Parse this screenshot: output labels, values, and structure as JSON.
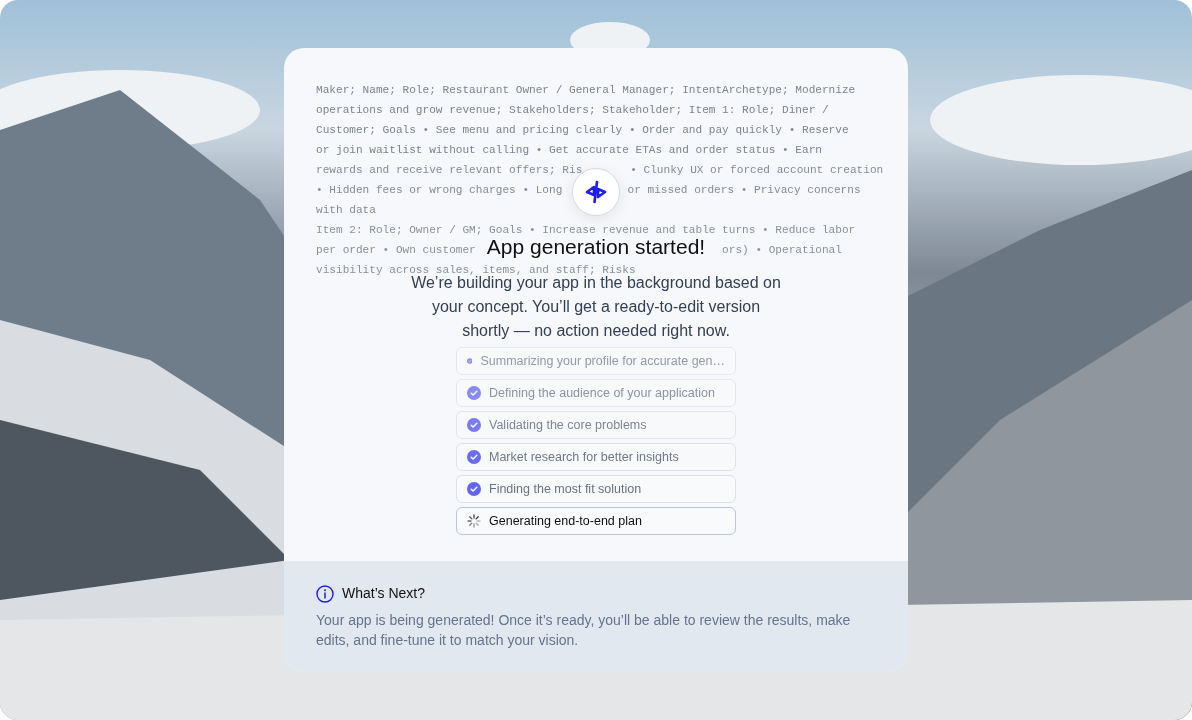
{
  "background_text": {
    "lines": [
      [
        "Maker; Name; Role; Restaurant Owner / General Manager; IntentArchetype; Modernize"
      ],
      [
        "operations and grow revenue; Stakeholders; Stakeholder; Item 1: Role; Diner /"
      ],
      [
        "Customer; Goals • See menu and pricing clearly • Order and pay quickly • Reserve"
      ],
      [
        "or join waitlist without calling • Get accurate ETAs and order status • Earn"
      ],
      [
        "rewards and receive relevant offers; Ris",
        "• Clunky UX or forced account creation"
      ],
      [
        "• Hidden fees or wrong charges • Long",
        "or missed orders • Privacy concerns"
      ],
      [
        "with data"
      ],
      [
        "Item 2: Role; Owner / GM; Goals • Increase revenue and table turns • Reduce labor"
      ],
      [
        "per order • Own customer",
        "ors) • Operational"
      ],
      [
        "visibility across sales, items, and staff; Risks"
      ]
    ]
  },
  "title": "App generation started!",
  "subtitle": "We’re building your app in the background based on your concept. You’ll get a ready-to-edit version shortly — no action needed right now.",
  "steps": [
    {
      "label": "Summarizing your profile for accurate gen…",
      "kind": "done"
    },
    {
      "label": "Defining the audience of your application",
      "kind": "done"
    },
    {
      "label": "Validating the core problems",
      "kind": "done"
    },
    {
      "label": "Market research for better insights",
      "kind": "done"
    },
    {
      "label": "Finding the most fit solution",
      "kind": "done"
    },
    {
      "label": "Generating end-to-end plan",
      "kind": "loading"
    }
  ],
  "next": {
    "title": "What’s Next?",
    "text": "Your app is being generated! Once it’s ready, you’ll be able to review the results, make edits, and fine-tune it to match your vision."
  }
}
